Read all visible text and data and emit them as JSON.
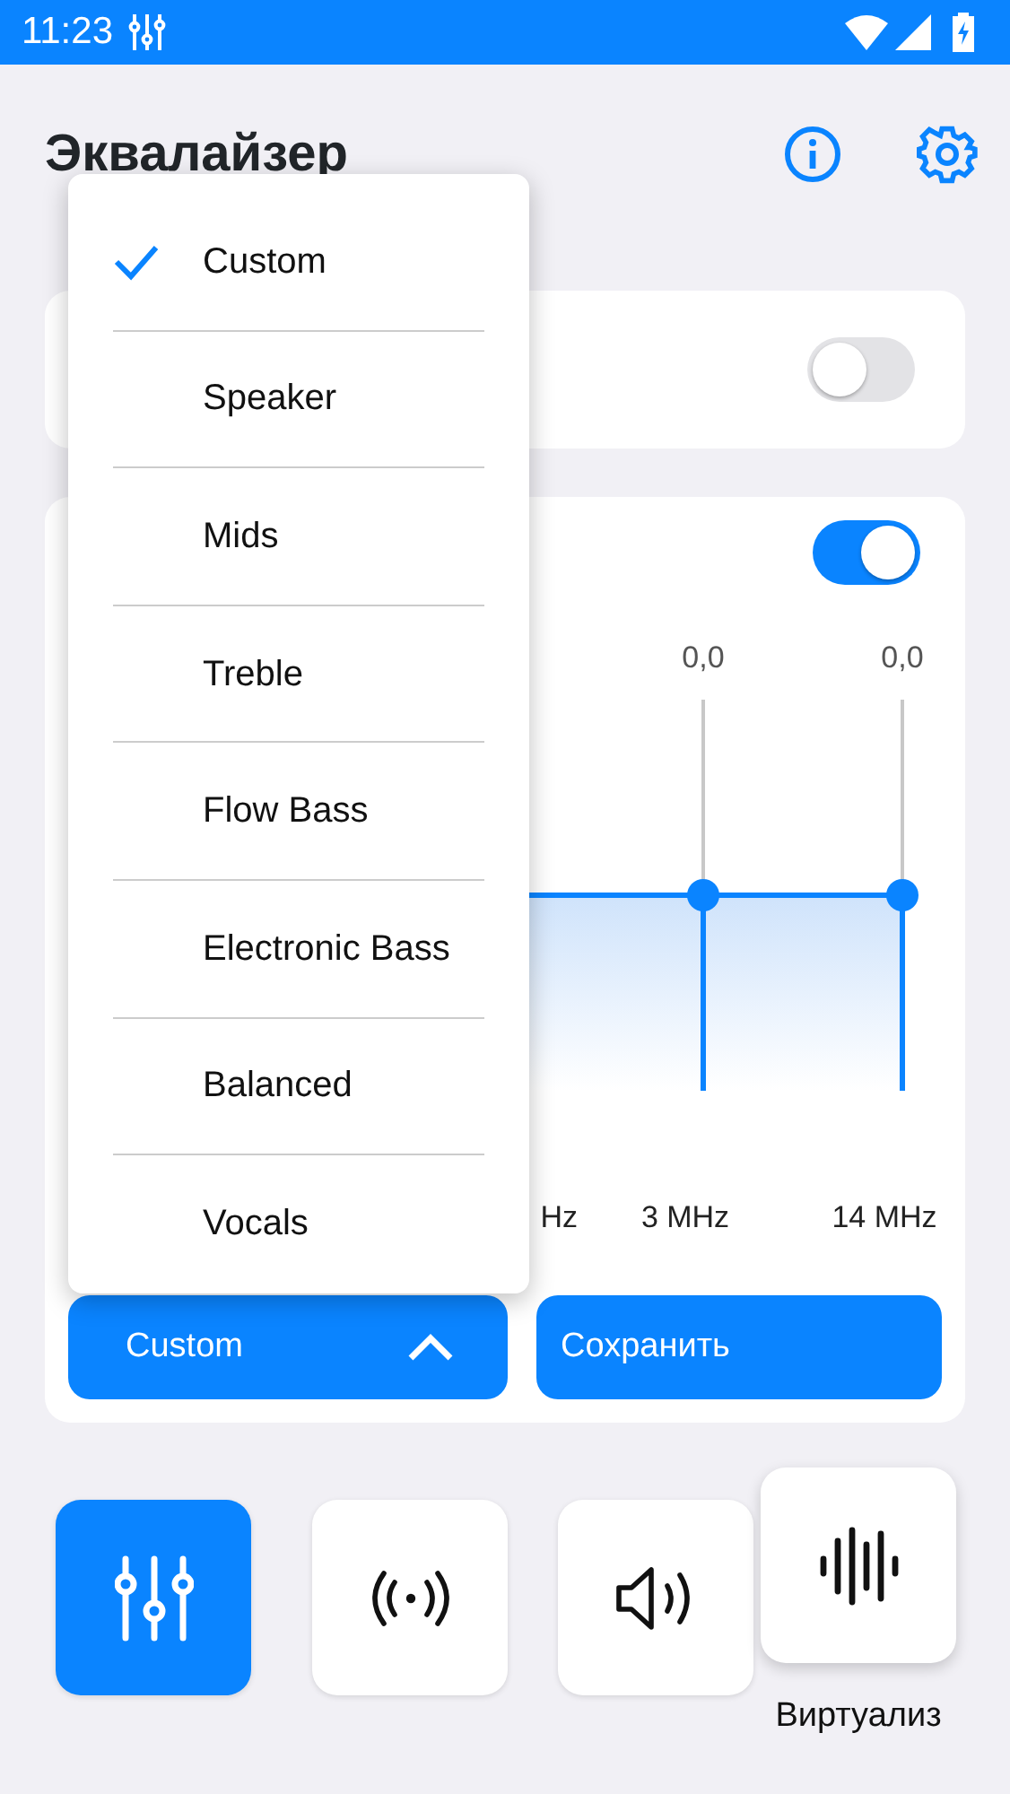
{
  "status_bar": {
    "time": "11:23"
  },
  "header": {
    "title": "Эквалайзер"
  },
  "cards": [
    {
      "toggle_on": false
    },
    {
      "toggle_on": true
    }
  ],
  "bands": [
    {
      "value": "0,0",
      "frequency": "3 MHz",
      "level": 0.5
    },
    {
      "value": "0,0",
      "frequency": "14 MHz",
      "level": 0.5
    }
  ],
  "hidden_frequency": "Hz",
  "preset_button": {
    "label": "Custom",
    "expanded": true
  },
  "save_button": {
    "label": "Сохранить"
  },
  "preset_menu": [
    {
      "label": "Custom",
      "selected": true
    },
    {
      "label": "Speaker",
      "selected": false
    },
    {
      "label": "Mids",
      "selected": false
    },
    {
      "label": "Treble",
      "selected": false
    },
    {
      "label": "Flow Bass",
      "selected": false
    },
    {
      "label": "Electronic Bass",
      "selected": false
    },
    {
      "label": "Balanced",
      "selected": false
    },
    {
      "label": "Vocals",
      "selected": false
    }
  ],
  "tools": [
    {
      "kind": "equalizer",
      "selected": true
    },
    {
      "kind": "bass",
      "selected": false
    },
    {
      "kind": "volume",
      "selected": false
    },
    {
      "kind": "virtualizer",
      "selected": false,
      "raised": true,
      "label": "Виртуализ"
    }
  ]
}
